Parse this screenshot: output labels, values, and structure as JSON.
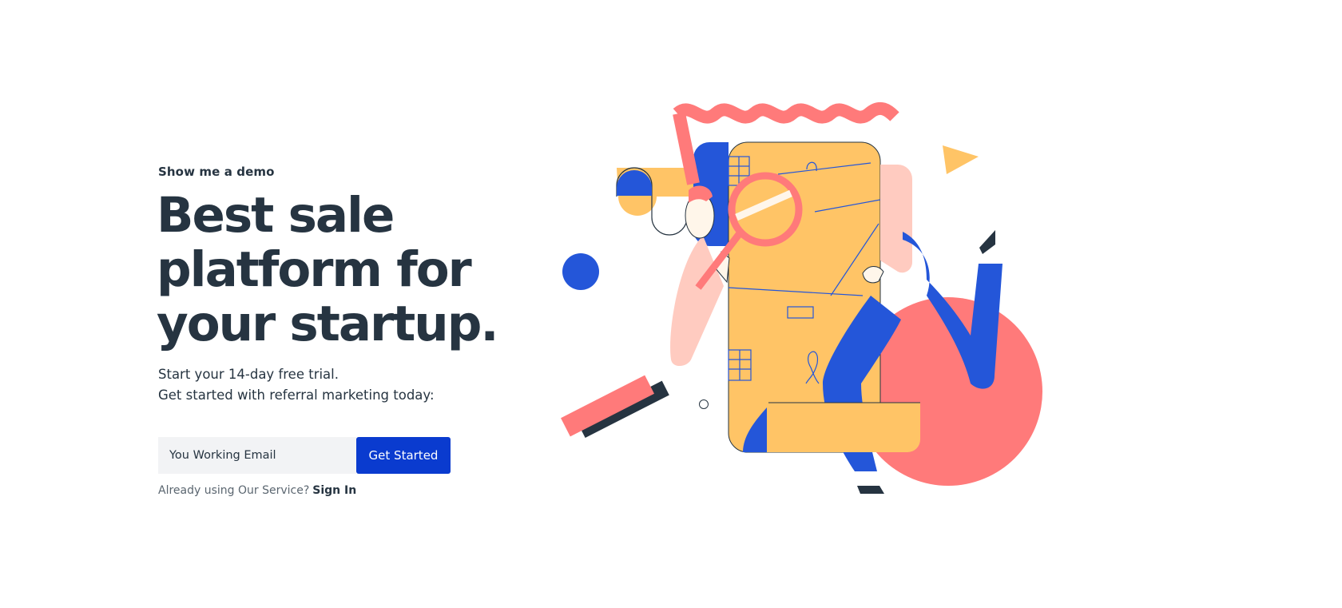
{
  "hero": {
    "eyebrow": "Show me a demo",
    "headline": [
      "Best sale",
      "platform for",
      "your startup."
    ],
    "subtext": [
      "Start your 14-day free trial.",
      "Get started with referral marketing today:"
    ]
  },
  "signup": {
    "email_placeholder": "You Working Email",
    "email_value": "",
    "cta_label": "Get Started"
  },
  "signin": {
    "prompt": "Already using Our Service?",
    "link_label": "Sign In"
  },
  "colors": {
    "text": "#263441",
    "primary": "#0a3bcf",
    "input_bg": "#f2f3f5",
    "coral": "#ff7a7a",
    "yellow": "#ffc466",
    "blue": "#2456d9",
    "pink": "#ffcbc0"
  },
  "illustration": {
    "icon": "person-with-magnifying-glass-illustration"
  }
}
